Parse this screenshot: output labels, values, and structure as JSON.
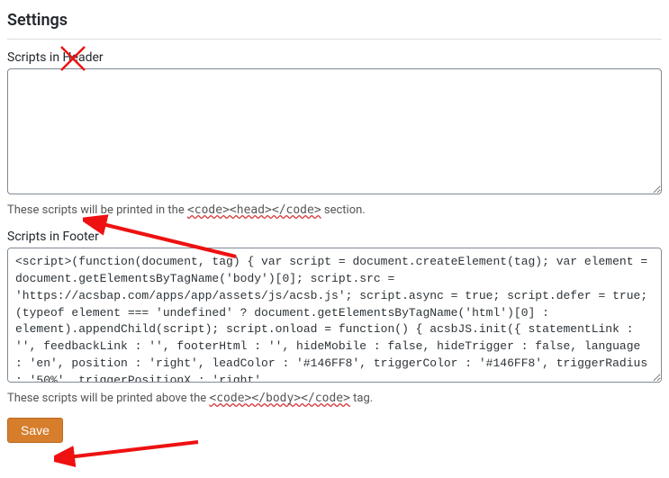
{
  "page": {
    "title": "Settings"
  },
  "header": {
    "label": "Scripts in Header",
    "value": "",
    "help_prefix": "These scripts will be printed in the ",
    "help_code": "<code><head></code>",
    "help_suffix": " section."
  },
  "footer": {
    "label": "Scripts in Footer",
    "value": "<script>(function(document, tag) { var script = document.createElement(tag); var element = document.getElementsByTagName('body')[0]; script.src = 'https://acsbap.com/apps/app/assets/js/acsb.js'; script.async = true; script.defer = true; (typeof element === 'undefined' ? document.getElementsByTagName('html')[0] : element).appendChild(script); script.onload = function() { acsbJS.init({ statementLink : '', feedbackLink : '', footerHtml : '', hideMobile : false, hideTrigger : false, language : 'en', position : 'right', leadColor : '#146FF8', triggerColor : '#146FF8', triggerRadius : '50%', triggerPositionX : 'right',",
    "help_prefix": "These scripts will be printed above the ",
    "help_code": "<code></body></code>",
    "help_suffix": " tag."
  },
  "actions": {
    "save_label": "Save"
  }
}
